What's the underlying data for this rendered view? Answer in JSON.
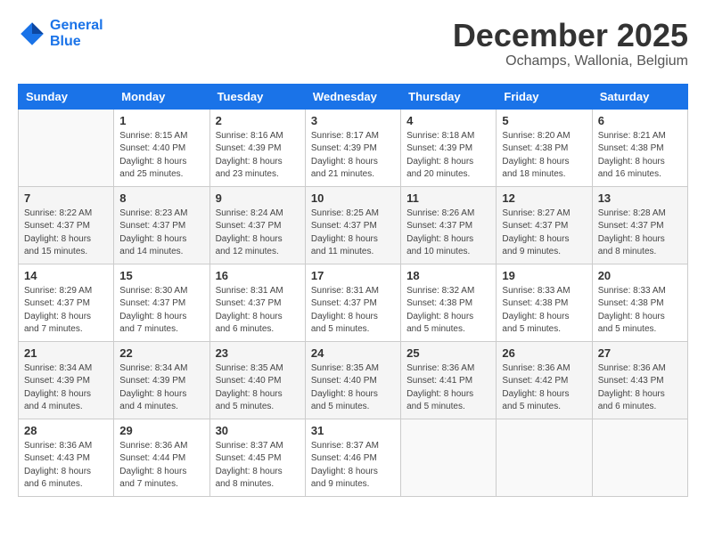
{
  "logo": {
    "line1": "General",
    "line2": "Blue"
  },
  "title": "December 2025",
  "subtitle": "Ochamps, Wallonia, Belgium",
  "weekdays": [
    "Sunday",
    "Monday",
    "Tuesday",
    "Wednesday",
    "Thursday",
    "Friday",
    "Saturday"
  ],
  "weeks": [
    [
      {
        "day": "",
        "info": ""
      },
      {
        "day": "1",
        "info": "Sunrise: 8:15 AM\nSunset: 4:40 PM\nDaylight: 8 hours\nand 25 minutes."
      },
      {
        "day": "2",
        "info": "Sunrise: 8:16 AM\nSunset: 4:39 PM\nDaylight: 8 hours\nand 23 minutes."
      },
      {
        "day": "3",
        "info": "Sunrise: 8:17 AM\nSunset: 4:39 PM\nDaylight: 8 hours\nand 21 minutes."
      },
      {
        "day": "4",
        "info": "Sunrise: 8:18 AM\nSunset: 4:39 PM\nDaylight: 8 hours\nand 20 minutes."
      },
      {
        "day": "5",
        "info": "Sunrise: 8:20 AM\nSunset: 4:38 PM\nDaylight: 8 hours\nand 18 minutes."
      },
      {
        "day": "6",
        "info": "Sunrise: 8:21 AM\nSunset: 4:38 PM\nDaylight: 8 hours\nand 16 minutes."
      }
    ],
    [
      {
        "day": "7",
        "info": "Sunrise: 8:22 AM\nSunset: 4:37 PM\nDaylight: 8 hours\nand 15 minutes."
      },
      {
        "day": "8",
        "info": "Sunrise: 8:23 AM\nSunset: 4:37 PM\nDaylight: 8 hours\nand 14 minutes."
      },
      {
        "day": "9",
        "info": "Sunrise: 8:24 AM\nSunset: 4:37 PM\nDaylight: 8 hours\nand 12 minutes."
      },
      {
        "day": "10",
        "info": "Sunrise: 8:25 AM\nSunset: 4:37 PM\nDaylight: 8 hours\nand 11 minutes."
      },
      {
        "day": "11",
        "info": "Sunrise: 8:26 AM\nSunset: 4:37 PM\nDaylight: 8 hours\nand 10 minutes."
      },
      {
        "day": "12",
        "info": "Sunrise: 8:27 AM\nSunset: 4:37 PM\nDaylight: 8 hours\nand 9 minutes."
      },
      {
        "day": "13",
        "info": "Sunrise: 8:28 AM\nSunset: 4:37 PM\nDaylight: 8 hours\nand 8 minutes."
      }
    ],
    [
      {
        "day": "14",
        "info": "Sunrise: 8:29 AM\nSunset: 4:37 PM\nDaylight: 8 hours\nand 7 minutes."
      },
      {
        "day": "15",
        "info": "Sunrise: 8:30 AM\nSunset: 4:37 PM\nDaylight: 8 hours\nand 7 minutes."
      },
      {
        "day": "16",
        "info": "Sunrise: 8:31 AM\nSunset: 4:37 PM\nDaylight: 8 hours\nand 6 minutes."
      },
      {
        "day": "17",
        "info": "Sunrise: 8:31 AM\nSunset: 4:37 PM\nDaylight: 8 hours\nand 5 minutes."
      },
      {
        "day": "18",
        "info": "Sunrise: 8:32 AM\nSunset: 4:38 PM\nDaylight: 8 hours\nand 5 minutes."
      },
      {
        "day": "19",
        "info": "Sunrise: 8:33 AM\nSunset: 4:38 PM\nDaylight: 8 hours\nand 5 minutes."
      },
      {
        "day": "20",
        "info": "Sunrise: 8:33 AM\nSunset: 4:38 PM\nDaylight: 8 hours\nand 5 minutes."
      }
    ],
    [
      {
        "day": "21",
        "info": "Sunrise: 8:34 AM\nSunset: 4:39 PM\nDaylight: 8 hours\nand 4 minutes."
      },
      {
        "day": "22",
        "info": "Sunrise: 8:34 AM\nSunset: 4:39 PM\nDaylight: 8 hours\nand 4 minutes."
      },
      {
        "day": "23",
        "info": "Sunrise: 8:35 AM\nSunset: 4:40 PM\nDaylight: 8 hours\nand 5 minutes."
      },
      {
        "day": "24",
        "info": "Sunrise: 8:35 AM\nSunset: 4:40 PM\nDaylight: 8 hours\nand 5 minutes."
      },
      {
        "day": "25",
        "info": "Sunrise: 8:36 AM\nSunset: 4:41 PM\nDaylight: 8 hours\nand 5 minutes."
      },
      {
        "day": "26",
        "info": "Sunrise: 8:36 AM\nSunset: 4:42 PM\nDaylight: 8 hours\nand 5 minutes."
      },
      {
        "day": "27",
        "info": "Sunrise: 8:36 AM\nSunset: 4:43 PM\nDaylight: 8 hours\nand 6 minutes."
      }
    ],
    [
      {
        "day": "28",
        "info": "Sunrise: 8:36 AM\nSunset: 4:43 PM\nDaylight: 8 hours\nand 6 minutes."
      },
      {
        "day": "29",
        "info": "Sunrise: 8:36 AM\nSunset: 4:44 PM\nDaylight: 8 hours\nand 7 minutes."
      },
      {
        "day": "30",
        "info": "Sunrise: 8:37 AM\nSunset: 4:45 PM\nDaylight: 8 hours\nand 8 minutes."
      },
      {
        "day": "31",
        "info": "Sunrise: 8:37 AM\nSunset: 4:46 PM\nDaylight: 8 hours\nand 9 minutes."
      },
      {
        "day": "",
        "info": ""
      },
      {
        "day": "",
        "info": ""
      },
      {
        "day": "",
        "info": ""
      }
    ]
  ]
}
